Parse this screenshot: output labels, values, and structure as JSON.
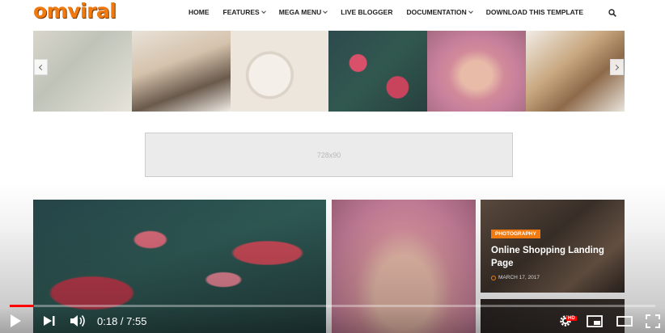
{
  "header": {
    "logo": "omviral",
    "nav": [
      {
        "label": "HOME",
        "dropdown": false
      },
      {
        "label": "FEATURES",
        "dropdown": true
      },
      {
        "label": "MEGA MENU",
        "dropdown": true
      },
      {
        "label": "LIVE BLOGGER",
        "dropdown": false
      },
      {
        "label": "DOCUMENTATION",
        "dropdown": true
      },
      {
        "label": "DOWNLOAD THIS TEMPLATE",
        "dropdown": false
      }
    ],
    "search_icon": "search-icon"
  },
  "ad": {
    "label": "728x90"
  },
  "featured": {
    "small_post": {
      "category": "PHOTOGRAPHY",
      "title": "Online Shopping Landing Page",
      "date": "MARCH 17, 2017"
    }
  },
  "player": {
    "time": "0:18 / 7:55",
    "progress": 0.038,
    "hd_badge": "HD"
  },
  "colors": {
    "brand": "#f07a10",
    "progress": "#ff0000"
  }
}
